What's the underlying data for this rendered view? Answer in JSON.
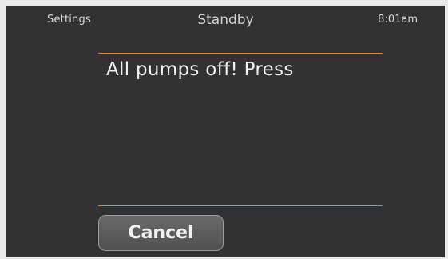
{
  "status_bar": {
    "settings_label": "Settings",
    "title": "Standby",
    "time": "8:01am"
  },
  "dialog": {
    "message": "All pumps off! Press",
    "cancel_label": "Cancel"
  },
  "colors": {
    "screen_background": "#323232",
    "accent_divider": "#d98a2b",
    "button_background": "#5a5a5a"
  }
}
